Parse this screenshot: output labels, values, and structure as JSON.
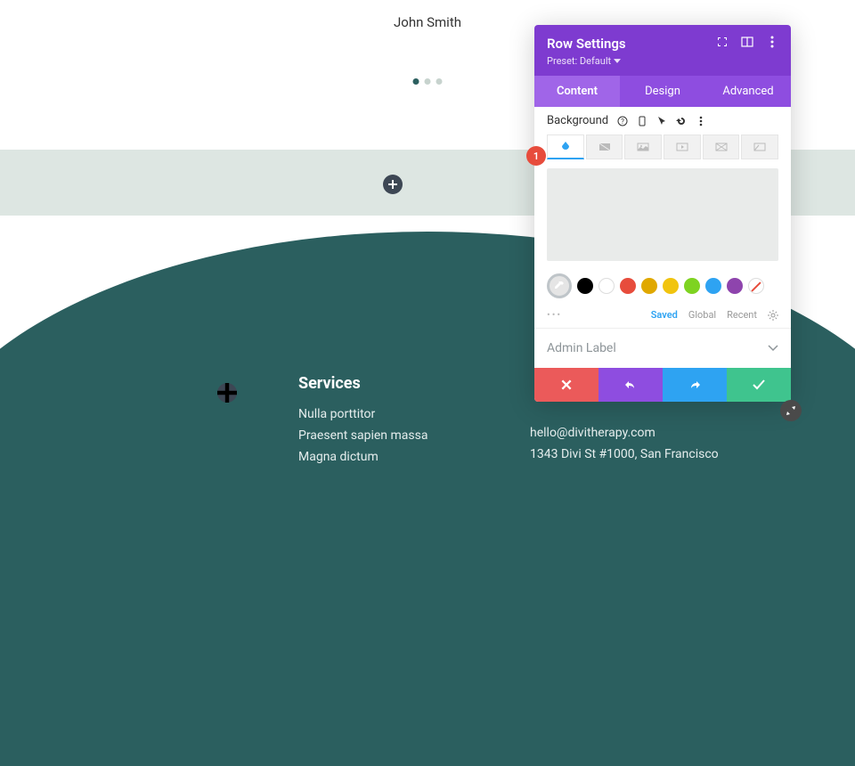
{
  "page_name": "John Smith",
  "badge": "1",
  "panel": {
    "title": "Row Settings",
    "preset_label": "Preset: Default",
    "tabs": {
      "content": "Content",
      "design": "Design",
      "advanced": "Advanced"
    },
    "background_label": "Background",
    "swatches": [
      "#000000",
      "#ffffff",
      "#e74c3c",
      "#e0a800",
      "#f1c40f",
      "#7ed321",
      "#2ea3f2",
      "#8e44ad"
    ],
    "palette": {
      "saved": "Saved",
      "global": "Global",
      "recent": "Recent"
    },
    "admin_label": "Admin Label"
  },
  "services": {
    "heading": "Services",
    "items": [
      "Nulla porttitor",
      "Praesent sapien massa",
      "Magna dictum"
    ]
  },
  "contact": {
    "email": "hello@divitherapy.com",
    "address": "1343 Divi St #1000, San Francisco"
  }
}
